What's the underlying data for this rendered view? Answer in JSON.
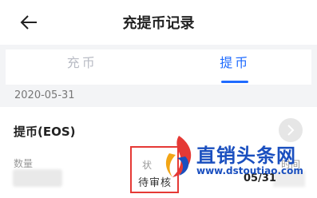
{
  "header": {
    "title": "充提币记录",
    "back_icon": "back-arrow-icon"
  },
  "tabs": [
    {
      "label": "充币",
      "active": false
    },
    {
      "label": "提币",
      "active": true
    }
  ],
  "date_group": {
    "date": "2020-05-31"
  },
  "record": {
    "title": "提币(EOS)",
    "chevron_icon": "chevron-right-icon",
    "quantity_label": "数量",
    "status_label": "状",
    "status_value": "待审核",
    "time_label": "时间",
    "time_value": "05/31"
  },
  "watermark": {
    "title": "直销头条网",
    "url": "www.dstoutiao.com"
  },
  "colors": {
    "accent": "#1f6bff",
    "highlight_box": "#e53935",
    "watermark": "#1a4fbf"
  }
}
